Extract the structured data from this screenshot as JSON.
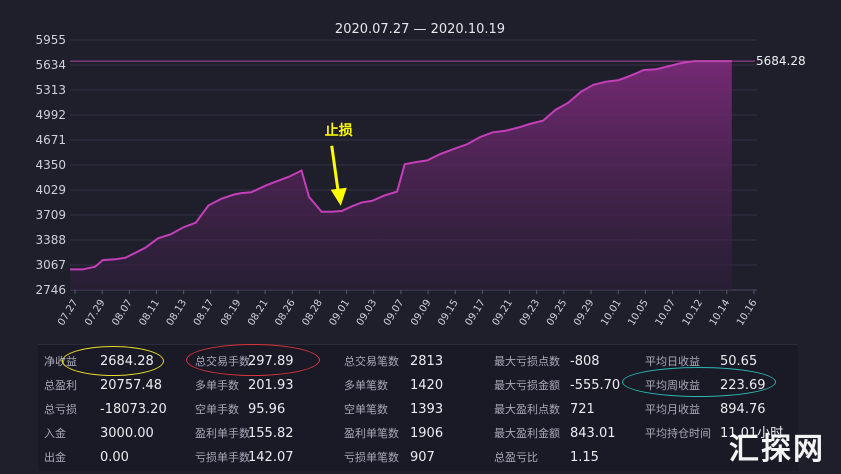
{
  "chart_data": {
    "type": "area",
    "title": "2020.07.27 — 2020.10.19",
    "xlabel": "",
    "ylabel": "",
    "ylim": [
      2746,
      5955
    ],
    "yticks": [
      2746,
      3067,
      3388,
      3709,
      4029,
      4350,
      4671,
      4992,
      5313,
      5634,
      5955
    ],
    "xtick_labels": [
      "07.27",
      "07.29",
      "08.07",
      "08.11",
      "08.13",
      "08.17",
      "08.19",
      "08.21",
      "08.26",
      "08.28",
      "09.01",
      "09.03",
      "09.07",
      "09.09",
      "09.15",
      "09.17",
      "09.21",
      "09.23",
      "09.25",
      "09.29",
      "10.01",
      "10.05",
      "10.07",
      "10.12",
      "10.14",
      "10.16"
    ],
    "x_range": [
      0,
      27.3
    ],
    "series": [
      {
        "x": [
          0,
          0.5,
          1,
          1.3,
          1.8,
          2.2,
          2.7,
          3,
          3.5,
          4,
          4.5,
          5,
          5.5,
          6,
          6.5,
          6.8,
          7.2,
          7.8,
          8.2,
          8.7,
          9.2,
          9.5,
          10,
          10.4,
          10.8,
          11.2,
          11.6,
          12,
          12.5,
          13,
          13.3,
          13.8,
          14.2,
          14.7,
          15.2,
          15.8,
          16.3,
          16.8,
          17.3,
          17.8,
          18.3,
          18.8,
          19.3,
          19.8,
          20.3,
          20.8,
          21.3,
          21.8,
          22.3,
          22.8,
          23.3,
          23.8,
          24.3,
          24.8,
          25.3,
          25.8,
          26.3
        ],
        "values": [
          3010,
          3010,
          3045,
          3130,
          3140,
          3160,
          3240,
          3290,
          3410,
          3460,
          3550,
          3610,
          3830,
          3915,
          3970,
          3990,
          4000,
          4090,
          4140,
          4200,
          4280,
          3940,
          3750,
          3750,
          3760,
          3820,
          3870,
          3890,
          3960,
          4010,
          4360,
          4390,
          4410,
          4490,
          4550,
          4620,
          4710,
          4770,
          4790,
          4830,
          4880,
          4920,
          5060,
          5150,
          5290,
          5380,
          5420,
          5440,
          5500,
          5570,
          5580,
          5620,
          5660,
          5684.28,
          5684.28,
          5684.28,
          5684.28
        ]
      }
    ],
    "last_value_label": "5684.28",
    "annotation": {
      "text": "止损",
      "x": 10.6,
      "y": 3750
    },
    "colors": {
      "line": "#c43fb9",
      "fill_top": "#7a2a78",
      "fill_bottom": "#2d1f3a",
      "annotation": "#ffff00",
      "reference_line": "#b84aa8"
    },
    "grid": true
  },
  "stats": {
    "columns": [
      [
        {
          "label": "净收益",
          "value": "2684.28"
        },
        {
          "label": "总盈利",
          "value": "20757.48"
        },
        {
          "label": "总亏损",
          "value": "-18073.20"
        },
        {
          "label": "入金",
          "value": "3000.00"
        },
        {
          "label": "出金",
          "value": "0.00"
        }
      ],
      [
        {
          "label": "总交易手数",
          "value": "297.89"
        },
        {
          "label": "多单手数",
          "value": "201.93"
        },
        {
          "label": "空单手数",
          "value": "95.96"
        },
        {
          "label": "盈利单手数",
          "value": "155.82"
        },
        {
          "label": "亏损单手数",
          "value": "142.07"
        }
      ],
      [
        {
          "label": "总交易笔数",
          "value": "2813"
        },
        {
          "label": "多单笔数",
          "value": "1420"
        },
        {
          "label": "空单笔数",
          "value": "1393"
        },
        {
          "label": "盈利单笔数",
          "value": "1906"
        },
        {
          "label": "亏损单笔数",
          "value": "907"
        }
      ],
      [
        {
          "label": "最大亏损点数",
          "value": "-808"
        },
        {
          "label": "最大亏损金额",
          "value": "-555.70"
        },
        {
          "label": "最大盈利点数",
          "value": "721"
        },
        {
          "label": "最大盈利金额",
          "value": "843.01"
        },
        {
          "label": "总盈亏比",
          "value": "1.15"
        }
      ],
      [
        {
          "label": "平均日收益",
          "value": "50.65"
        },
        {
          "label": "平均周收益",
          "value": "223.69"
        },
        {
          "label": "平均月收益",
          "value": "894.76"
        },
        {
          "label": "平均持仓时间",
          "value": "11.01小时"
        }
      ]
    ],
    "highlight_colors": {
      "yellow": "#e6dd2a",
      "red": "#d8353a",
      "cyan": "#2bb7b2"
    }
  },
  "watermark": "汇探网"
}
